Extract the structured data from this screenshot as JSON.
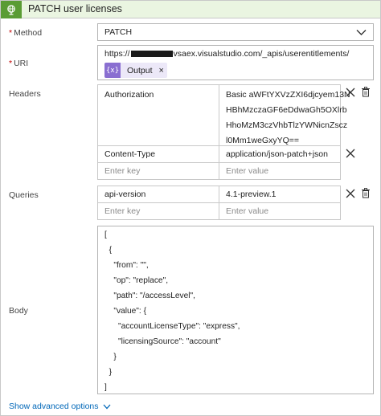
{
  "header": {
    "title": "PATCH user licenses"
  },
  "method": {
    "label": "Method",
    "required_mark": "*",
    "value": "PATCH"
  },
  "uri": {
    "label": "URI",
    "required_mark": "*",
    "prefix": "https://",
    "suffix": "vsaex.visualstudio.com/_apis/userentitlements/",
    "token_label": "Output",
    "token_remove": "×"
  },
  "headers": {
    "label": "Headers",
    "rows": [
      {
        "key": "Authorization",
        "value_lines": [
          "Basic aWFtYXVzZXI6djcyem13N",
          "HBhMzczaGF6eDdwaGh5OXlrb",
          "HhoMzM3czVhbTlzYWNicnZscz",
          "l0Mm1weGxyYQ=="
        ]
      },
      {
        "key": "Content-Type",
        "value_lines": [
          "application/json-patch+json"
        ]
      }
    ],
    "key_placeholder": "Enter key",
    "value_placeholder": "Enter value"
  },
  "queries": {
    "label": "Queries",
    "rows": [
      {
        "key": "api-version",
        "value": "4.1-preview.1"
      }
    ],
    "key_placeholder": "Enter key",
    "value_placeholder": "Enter value"
  },
  "body": {
    "label": "Body",
    "lines": [
      "[",
      "  {",
      "    \"from\": \"\",",
      "    \"op\": \"replace\",",
      "    \"path\": \"/accessLevel\",",
      "    \"value\": {",
      "      \"accountLicenseType\": \"express\",",
      "      \"licensingSource\": \"account\"",
      "    }",
      "  }",
      "]"
    ]
  },
  "advanced": {
    "label": "Show advanced options"
  },
  "colors": {
    "header_bg": "#eaf5e1",
    "step_icon_bg": "#5a9c34",
    "token_bg": "#8a6fd1",
    "link": "#0067b8",
    "required": "#c00000"
  }
}
